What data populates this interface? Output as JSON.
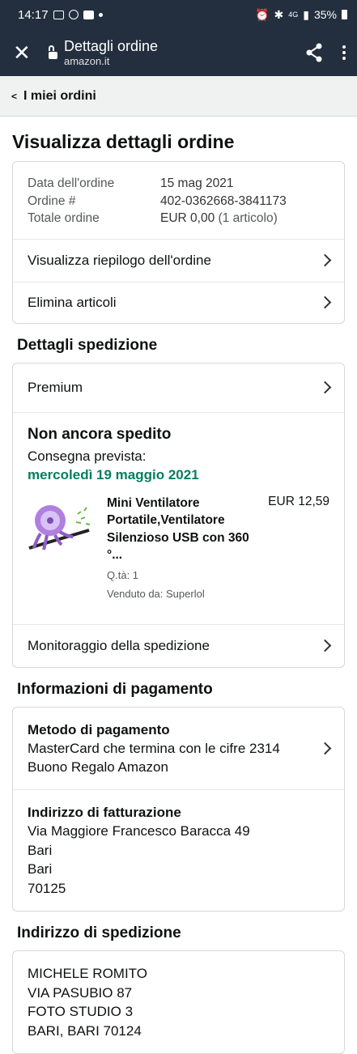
{
  "status_bar": {
    "time": "14:17",
    "network": "4G",
    "battery": "35%"
  },
  "app_bar": {
    "title": "Dettagli ordine",
    "domain": "amazon.it"
  },
  "breadcrumb": {
    "label": "I miei ordini"
  },
  "page_title": "Visualizza dettagli ordine",
  "order": {
    "date_label": "Data dell'ordine",
    "date_value": "15 mag 2021",
    "number_label": "Ordine #",
    "number_value": "402-0362668-3841173",
    "total_label": "Totale ordine",
    "total_value": "EUR 0,00",
    "total_items": "(1 articolo)",
    "summary_link": "Visualizza riepilogo dell'ordine",
    "delete_link": "Elimina articoli"
  },
  "shipping": {
    "heading": "Dettagli spedizione",
    "service": "Premium",
    "status": "Non ancora spedito",
    "delivery_label": "Consegna prevista:",
    "delivery_date": "mercoledì 19 maggio 2021",
    "item": {
      "name": "Mini Ventilatore Portatile,Ventilatore Silenzioso USB con 360 °...",
      "price": "EUR 12,59",
      "qty": "Q.tà: 1",
      "seller": "Venduto da: Superlol"
    },
    "tracking_link": "Monitoraggio della spedizione"
  },
  "payment": {
    "heading": "Informazioni di pagamento",
    "method_label": "Metodo di pagamento",
    "method_line1": "MasterCard che termina con le cifre 2314",
    "method_line2": "Buono Regalo Amazon",
    "billing_label": "Indirizzo di fatturazione",
    "billing_lines": [
      "Via Maggiore Francesco Baracca 49",
      "Bari",
      "Bari",
      "70125"
    ]
  },
  "delivery_address": {
    "heading": "Indirizzo di spedizione",
    "lines": [
      "MICHELE ROMITO",
      "VIA PASUBIO 87",
      "FOTO STUDIO 3",
      "BARI, BARI 70124"
    ]
  },
  "colors": {
    "header": "#232f3e",
    "delivery_green": "#067d62",
    "background": "#eaeded"
  }
}
